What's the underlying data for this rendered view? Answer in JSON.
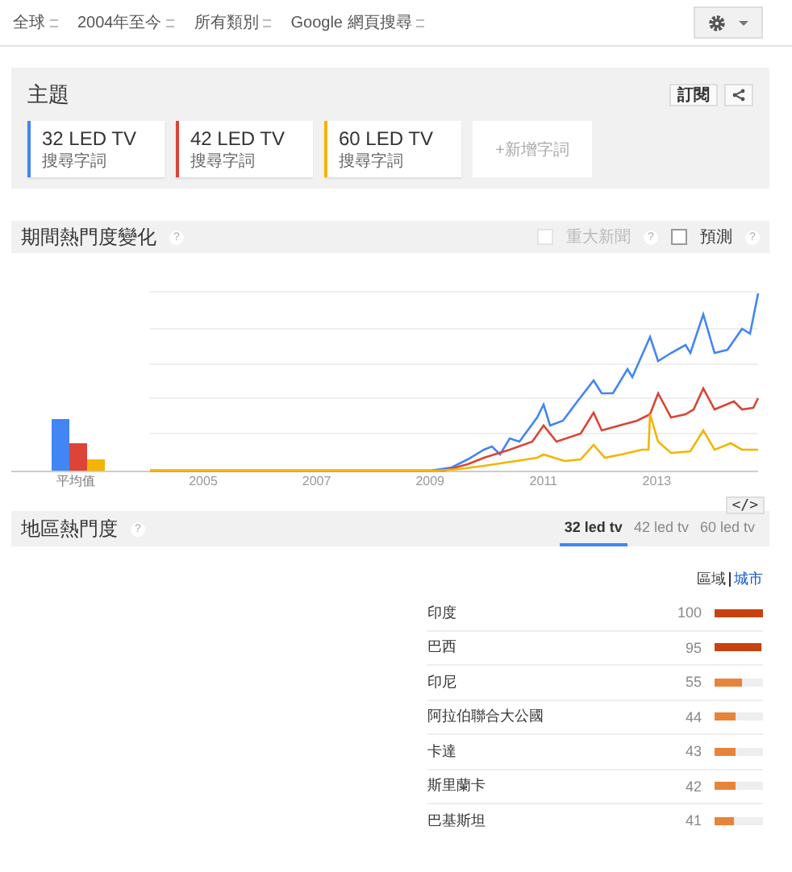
{
  "filters": [
    "全球",
    "2004年至今",
    "所有類別",
    "Google 網頁搜尋"
  ],
  "topics": {
    "title": "主題",
    "subscribe": "訂閱",
    "terms": [
      {
        "name": "32 LED TV",
        "type": "搜尋字詞",
        "color": "#4285f4"
      },
      {
        "name": "42 LED TV",
        "type": "搜尋字詞",
        "color": "#db4437"
      },
      {
        "name": "60 LED TV",
        "type": "搜尋字詞",
        "color": "#f4b400"
      }
    ],
    "add_term": "+新增字詞"
  },
  "interest_over_time": {
    "title": "期間熱門度變化",
    "help": "?",
    "news": {
      "label": "重大新聞",
      "checked": false,
      "disabled": true
    },
    "forecast": {
      "label": "預測",
      "checked": false
    },
    "average_label": "平均值",
    "years": [
      "2005",
      "2007",
      "2009",
      "2011",
      "2013"
    ],
    "embed": "</>"
  },
  "regional_interest": {
    "title": "地區熱門度",
    "help": "?",
    "tabs": [
      {
        "label": "32 led tv",
        "selected": true
      },
      {
        "label": "42 led tv",
        "selected": false
      },
      {
        "label": "60 led tv",
        "selected": false
      }
    ],
    "views": [
      {
        "label": "區域",
        "selected": true
      },
      {
        "label": "城市",
        "selected": false
      }
    ],
    "rows": [
      {
        "name": "印度",
        "value": "100",
        "level": 1.0
      },
      {
        "name": "巴西",
        "value": "95",
        "level": 0.95
      },
      {
        "name": "印尼",
        "value": "55",
        "level": 0.55
      },
      {
        "name": "阿拉伯聯合大公國",
        "value": "44",
        "level": 0.44
      },
      {
        "name": "卡達",
        "value": "43",
        "level": 0.43
      },
      {
        "name": "斯里蘭卡",
        "value": "42",
        "level": 0.42
      },
      {
        "name": "巴基斯坦",
        "value": "41",
        "level": 0.41
      }
    ]
  }
}
